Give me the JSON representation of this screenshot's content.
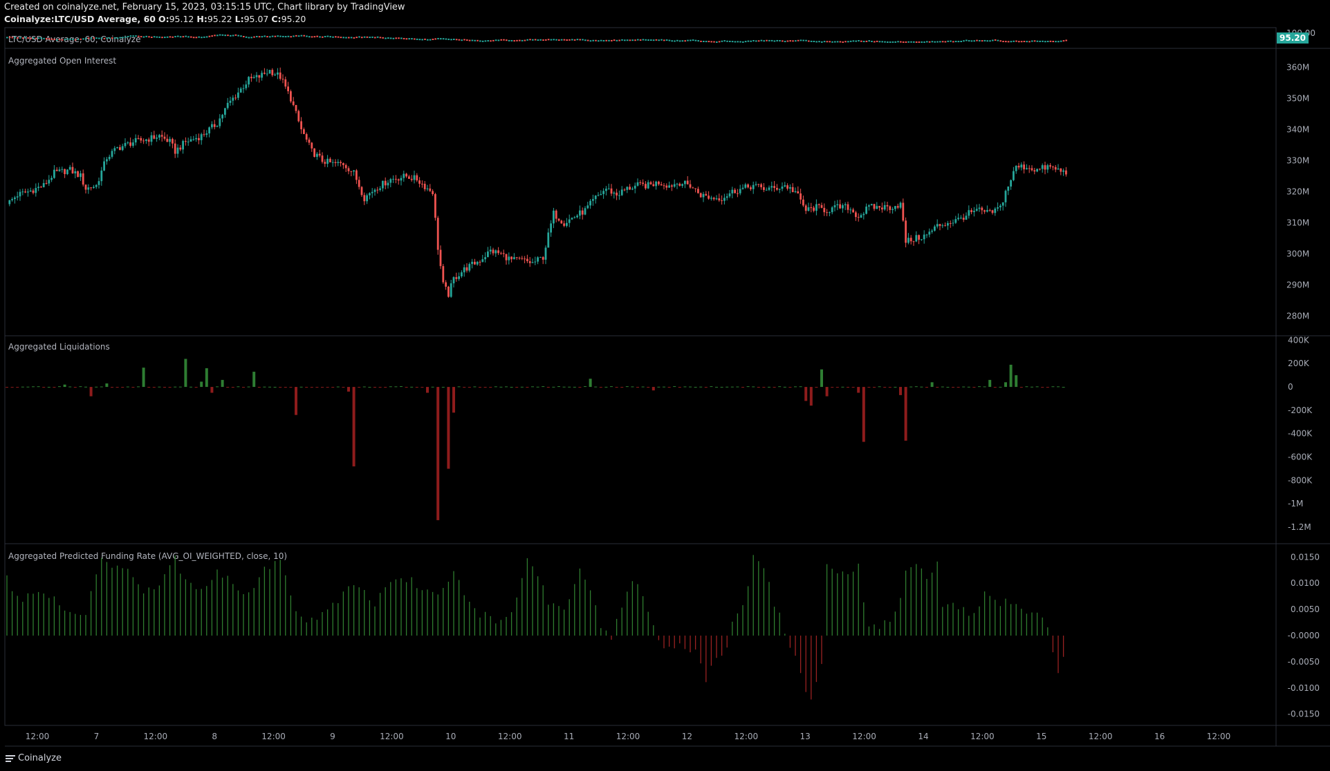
{
  "header": {
    "created_line": "Created on coinalyze.net, February 15, 2023, 03:15:15 UTC, Chart library by TradingView",
    "symbol": "Coinalyze:LTC/USD Average, 60",
    "o_label": "O:",
    "o_value": "95.12",
    "h_label": "H:",
    "h_value": "95.22",
    "l_label": "L:",
    "l_value": "95.07",
    "c_label": "C:",
    "c_value": "95.20"
  },
  "footer": {
    "brand": "Coinalyze",
    "menu_icon": "hamburger-menu-icon"
  },
  "colors": {
    "up": "#26a69a",
    "down": "#ef5350",
    "liq_up": "#2e7d32",
    "liq_down": "#8e1c1c",
    "fund_up": "#2f7d2f",
    "fund_down": "#9a2222",
    "price_badge": "#26a69a"
  },
  "chart_data": [
    {
      "type": "line",
      "title": "LTC/USD Average, 60, Coinalyze",
      "last_value": "95.20",
      "y_tick_labels": [
        "100.00"
      ],
      "note": "price pane (compressed), mostly flat near 95-100"
    },
    {
      "type": "candlestick",
      "title": "Aggregated Open Interest",
      "unit": "USD",
      "ylim": [
        275,
        365
      ],
      "y_tick_labels": [
        "360M",
        "350M",
        "340M",
        "330M",
        "320M",
        "310M",
        "300M",
        "290M",
        "280M"
      ],
      "y_tick_values": [
        360,
        350,
        340,
        330,
        320,
        310,
        300,
        290,
        280
      ],
      "anchors_millions": [
        [
          0,
          316
        ],
        [
          4,
          319
        ],
        [
          8,
          320
        ],
        [
          14,
          322
        ],
        [
          18,
          326
        ],
        [
          24,
          327
        ],
        [
          28,
          325
        ],
        [
          30,
          321
        ],
        [
          34,
          322
        ],
        [
          38,
          331
        ],
        [
          42,
          334
        ],
        [
          48,
          336
        ],
        [
          54,
          337
        ],
        [
          58,
          338
        ],
        [
          62,
          336
        ],
        [
          64,
          333
        ],
        [
          68,
          336
        ],
        [
          74,
          338
        ],
        [
          80,
          342
        ],
        [
          84,
          348
        ],
        [
          88,
          352
        ],
        [
          92,
          356
        ],
        [
          96,
          357
        ],
        [
          100,
          359
        ],
        [
          104,
          357
        ],
        [
          108,
          350
        ],
        [
          112,
          340
        ],
        [
          116,
          333
        ],
        [
          120,
          330
        ],
        [
          124,
          329
        ],
        [
          128,
          329
        ],
        [
          132,
          326
        ],
        [
          136,
          318
        ],
        [
          140,
          321
        ],
        [
          146,
          324
        ],
        [
          152,
          325
        ],
        [
          156,
          324
        ],
        [
          160,
          321
        ],
        [
          162,
          320
        ],
        [
          164,
          302
        ],
        [
          166,
          290
        ],
        [
          168,
          287
        ],
        [
          170,
          292
        ],
        [
          174,
          295
        ],
        [
          180,
          298
        ],
        [
          184,
          301
        ],
        [
          188,
          300
        ],
        [
          192,
          298
        ],
        [
          196,
          298
        ],
        [
          200,
          297
        ],
        [
          204,
          299
        ],
        [
          208,
          313
        ],
        [
          212,
          310
        ],
        [
          216,
          312
        ],
        [
          220,
          314
        ],
        [
          224,
          318
        ],
        [
          228,
          321
        ],
        [
          232,
          319
        ],
        [
          236,
          321
        ],
        [
          240,
          322
        ],
        [
          244,
          322
        ],
        [
          248,
          323
        ],
        [
          252,
          322
        ],
        [
          256,
          323
        ],
        [
          260,
          322
        ],
        [
          264,
          319
        ],
        [
          268,
          318
        ],
        [
          272,
          318
        ],
        [
          276,
          320
        ],
        [
          280,
          321
        ],
        [
          284,
          322
        ],
        [
          288,
          321
        ],
        [
          292,
          321
        ],
        [
          296,
          322
        ],
        [
          300,
          320
        ],
        [
          304,
          314
        ],
        [
          308,
          315
        ],
        [
          312,
          314
        ],
        [
          316,
          315
        ],
        [
          320,
          315
        ],
        [
          324,
          312
        ],
        [
          328,
          315
        ],
        [
          332,
          315
        ],
        [
          336,
          315
        ],
        [
          340,
          316
        ],
        [
          342,
          304
        ],
        [
          346,
          305
        ],
        [
          350,
          306
        ],
        [
          354,
          309
        ],
        [
          358,
          310
        ],
        [
          362,
          311
        ],
        [
          366,
          313
        ],
        [
          370,
          314
        ],
        [
          374,
          313
        ],
        [
          378,
          315
        ],
        [
          380,
          320
        ],
        [
          384,
          328
        ],
        [
          388,
          328
        ],
        [
          392,
          327
        ],
        [
          396,
          328
        ],
        [
          400,
          327
        ],
        [
          403,
          326
        ]
      ],
      "x_tick_labels": [
        "12:00",
        "7",
        "12:00",
        "8",
        "12:00",
        "9",
        "12:00",
        "10",
        "12:00",
        "11",
        "12:00",
        "12",
        "12:00",
        "13",
        "12:00",
        "14",
        "12:00",
        "15",
        "12:00",
        "16",
        "12:00"
      ]
    },
    {
      "type": "bar",
      "title": "Aggregated Liquidations",
      "ylim": [
        -1300000,
        420000
      ],
      "y_tick_labels": [
        "400K",
        "200K",
        "0",
        "-200K",
        "-400K",
        "-600K",
        "-800K",
        "-1M",
        "-1.2M"
      ],
      "y_tick_values": [
        400000,
        200000,
        0,
        -200000,
        -400000,
        -600000,
        -800000,
        -1000000,
        -1200000
      ],
      "spikes": [
        [
          22,
          20000
        ],
        [
          32,
          -80000
        ],
        [
          38,
          30000
        ],
        [
          52,
          165000
        ],
        [
          68,
          240000
        ],
        [
          74,
          45000
        ],
        [
          76,
          160000
        ],
        [
          78,
          -50000
        ],
        [
          82,
          60000
        ],
        [
          94,
          130000
        ],
        [
          110,
          -240000
        ],
        [
          130,
          -40000
        ],
        [
          132,
          -680000
        ],
        [
          160,
          -50000
        ],
        [
          164,
          -1140000
        ],
        [
          168,
          -700000
        ],
        [
          170,
          -220000
        ],
        [
          222,
          70000
        ],
        [
          246,
          -30000
        ],
        [
          304,
          -120000
        ],
        [
          306,
          -160000
        ],
        [
          310,
          150000
        ],
        [
          312,
          -80000
        ],
        [
          324,
          -50000
        ],
        [
          326,
          -470000
        ],
        [
          340,
          -70000
        ],
        [
          342,
          -460000
        ],
        [
          352,
          40000
        ],
        [
          374,
          60000
        ],
        [
          380,
          40000
        ],
        [
          382,
          190000
        ],
        [
          384,
          100000
        ]
      ]
    },
    {
      "type": "bar",
      "title": "Aggregated Predicted Funding Rate (AVG_OI_WEIGHTED, close, 10)",
      "ylim": [
        -0.0165,
        0.0165
      ],
      "y_tick_labels": [
        "0.0150",
        "0.0100",
        "0.0050",
        "-0.0000",
        "-0.0050",
        "-0.0100",
        "-0.0150"
      ],
      "y_tick_values": [
        0.015,
        0.01,
        0.005,
        0,
        -0.005,
        -0.01,
        -0.015
      ],
      "anchors": [
        [
          0,
          0.011
        ],
        [
          5,
          0.006
        ],
        [
          10,
          0.008
        ],
        [
          18,
          0.007
        ],
        [
          24,
          0.005
        ],
        [
          30,
          0.004
        ],
        [
          36,
          0.015
        ],
        [
          40,
          0.013
        ],
        [
          46,
          0.012
        ],
        [
          52,
          0.008
        ],
        [
          60,
          0.011
        ],
        [
          64,
          0.015
        ],
        [
          68,
          0.01
        ],
        [
          74,
          0.009
        ],
        [
          80,
          0.012
        ],
        [
          86,
          0.01
        ],
        [
          92,
          0.008
        ],
        [
          98,
          0.013
        ],
        [
          104,
          0.014
        ],
        [
          110,
          0.004
        ],
        [
          116,
          0.003
        ],
        [
          122,
          0.005
        ],
        [
          128,
          0.008
        ],
        [
          134,
          0.01
        ],
        [
          140,
          0.006
        ],
        [
          146,
          0.01
        ],
        [
          152,
          0.011
        ],
        [
          158,
          0.009
        ],
        [
          164,
          0.007
        ],
        [
          170,
          0.013
        ],
        [
          174,
          0.007
        ],
        [
          180,
          0.004
        ],
        [
          186,
          0.003
        ],
        [
          192,
          0.004
        ],
        [
          198,
          0.014
        ],
        [
          202,
          0.012
        ],
        [
          206,
          0.006
        ],
        [
          212,
          0.005
        ],
        [
          218,
          0.012
        ],
        [
          222,
          0.009
        ],
        [
          226,
          0.001
        ],
        [
          230,
          -0.0005
        ],
        [
          234,
          0.006
        ],
        [
          238,
          0.011
        ],
        [
          242,
          0.007
        ],
        [
          246,
          0.002
        ],
        [
          250,
          -0.003
        ],
        [
          254,
          -0.002
        ],
        [
          262,
          -0.003
        ],
        [
          266,
          -0.008
        ],
        [
          270,
          -0.005
        ],
        [
          274,
          -0.002
        ],
        [
          276,
          0.002
        ],
        [
          280,
          0.005
        ],
        [
          284,
          0.015
        ],
        [
          288,
          0.013
        ],
        [
          292,
          0.006
        ],
        [
          296,
          0.001
        ],
        [
          298,
          -0.002
        ],
        [
          302,
          -0.007
        ],
        [
          306,
          -0.013
        ],
        [
          310,
          -0.006
        ],
        [
          312,
          0.013
        ],
        [
          316,
          0.011
        ],
        [
          320,
          0.012
        ],
        [
          324,
          0.013
        ],
        [
          328,
          0.001
        ],
        [
          332,
          0.002
        ],
        [
          338,
          0.004
        ],
        [
          342,
          0.012
        ],
        [
          346,
          0.014
        ],
        [
          350,
          0.01
        ],
        [
          354,
          0.015
        ],
        [
          356,
          0.006
        ],
        [
          360,
          0.006
        ],
        [
          364,
          0.005
        ],
        [
          368,
          0.004
        ],
        [
          372,
          0.008
        ],
        [
          376,
          0.006
        ],
        [
          380,
          0.007
        ],
        [
          384,
          0.006
        ],
        [
          388,
          0.005
        ],
        [
          392,
          0.004
        ],
        [
          396,
          0.002
        ],
        [
          400,
          -0.007
        ],
        [
          403,
          -0.0035
        ]
      ]
    }
  ]
}
